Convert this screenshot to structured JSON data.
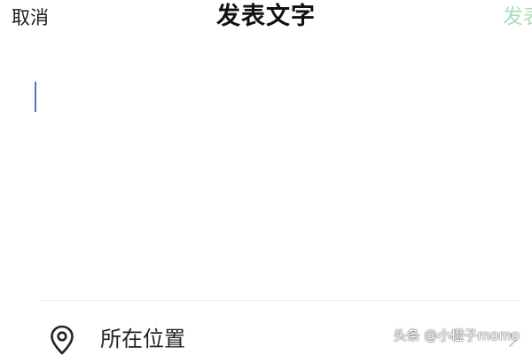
{
  "header": {
    "cancel_label": "取消",
    "title": "发表文字",
    "publish_label": "发表"
  },
  "editor": {
    "content": ""
  },
  "location": {
    "label": "所在位置"
  },
  "icons": {
    "location": "map-pin-icon",
    "chevron": "chevron-right-icon"
  },
  "colors": {
    "publish_disabled": "#a9dfb8",
    "caret": "#4f6fd8"
  },
  "watermark": {
    "text": "头条 @小橙子momo"
  }
}
